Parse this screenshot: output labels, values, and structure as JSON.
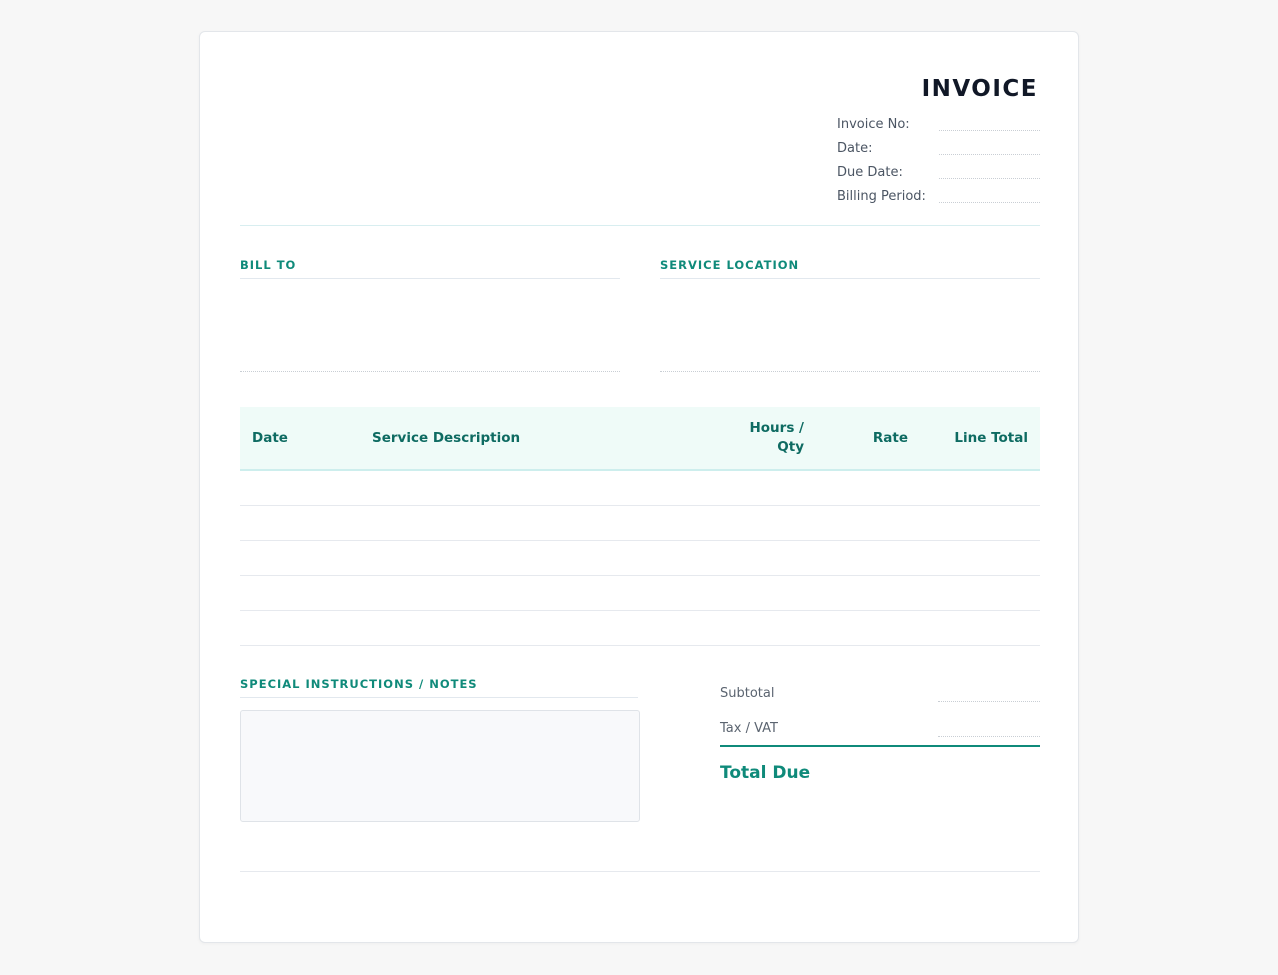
{
  "invoice": {
    "title": "INVOICE",
    "meta_fields": [
      {
        "label": "Invoice No:",
        "value": ""
      },
      {
        "label": "Date:",
        "value": ""
      },
      {
        "label": "Due Date:",
        "value": ""
      },
      {
        "label": "Billing Period:",
        "value": ""
      }
    ]
  },
  "bill_to": {
    "heading": "BILL TO"
  },
  "service_location": {
    "heading": "SERVICE LOCATION"
  },
  "table": {
    "columns": {
      "date": "Date",
      "description": "Service Description",
      "hours_qty_line1": "Hours /",
      "hours_qty_line2": "Qty",
      "rate": "Rate",
      "line_total": "Line Total"
    },
    "rows": []
  },
  "notes": {
    "heading": "SPECIAL INSTRUCTIONS / NOTES",
    "text": ""
  },
  "totals": {
    "subtotal_label": "Subtotal",
    "tax_label": "Tax / VAT",
    "total_due_label": "Total Due"
  },
  "colors": {
    "accent": "#0f8a7a",
    "table_header_bg": "#effbf8",
    "page_bg": "#f7f7f7"
  }
}
